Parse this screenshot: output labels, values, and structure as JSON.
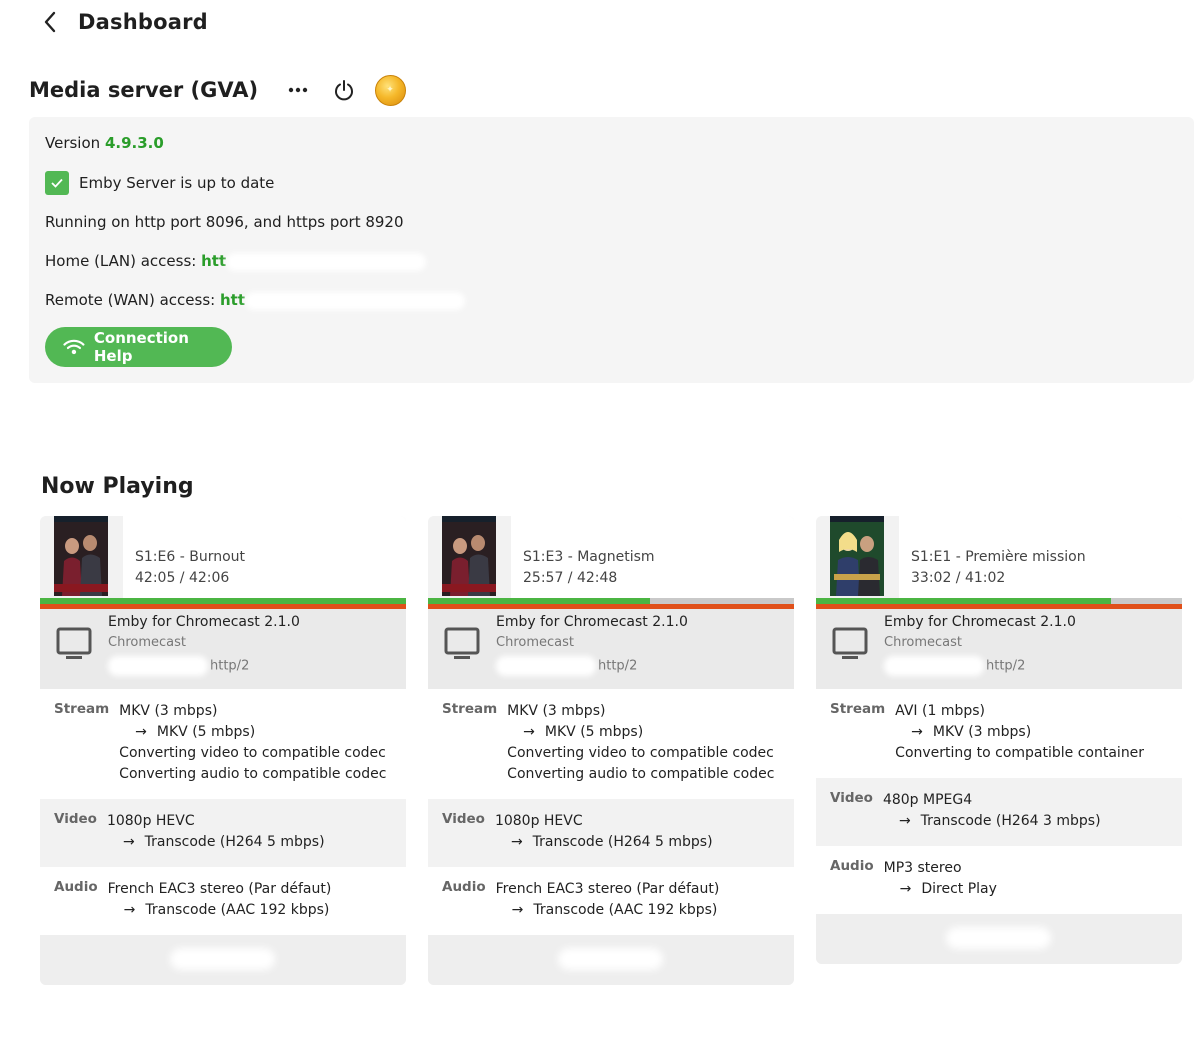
{
  "header": {
    "title": "Dashboard"
  },
  "server": {
    "name": "Media server (GVA)",
    "version_label": "Version ",
    "version": "4.9.3.0",
    "update_status": "Emby Server is up to date",
    "ports_text": "Running on http port 8096, and https port 8920",
    "lan_label": "Home (LAN) access: ",
    "lan_url_visible": "htt",
    "wan_label": "Remote (WAN) access: ",
    "wan_url_visible": "htt",
    "connection_help_label": "Connection Help"
  },
  "now_playing": {
    "title": "Now Playing",
    "sessions": [
      {
        "episode": "S1:E6 - Burnout",
        "time": "42:05 / 42:06",
        "progress": 0.999,
        "device_app": "Emby for Chromecast 2.1.0",
        "device_type": "Chromecast",
        "protocol": "http/2",
        "stream_label": "Stream",
        "stream_lines": [
          "MKV (3 mbps)",
          "MKV (5 mbps)",
          "Converting video to compatible codec",
          "Converting audio to compatible codec"
        ],
        "video_label": "Video",
        "video_lines": [
          "1080p HEVC",
          "Transcode (H264 5 mbps)"
        ],
        "audio_label": "Audio",
        "audio_lines": [
          "French EAC3 stereo (Par défaut)",
          "Transcode (AAC 192 kbps)"
        ]
      },
      {
        "episode": "S1:E3 - Magnetism",
        "time": "25:57 / 42:48",
        "progress": 0.606,
        "device_app": "Emby for Chromecast 2.1.0",
        "device_type": "Chromecast",
        "protocol": "http/2",
        "stream_label": "Stream",
        "stream_lines": [
          "MKV (3 mbps)",
          "MKV (5 mbps)",
          "Converting video to compatible codec",
          "Converting audio to compatible codec"
        ],
        "video_label": "Video",
        "video_lines": [
          "1080p HEVC",
          "Transcode (H264 5 mbps)"
        ],
        "audio_label": "Audio",
        "audio_lines": [
          "French EAC3 stereo (Par défaut)",
          "Transcode (AAC 192 kbps)"
        ]
      },
      {
        "episode": "S1:E1 - Première mission",
        "time": "33:02 / 41:02",
        "progress": 0.805,
        "device_app": "Emby for Chromecast 2.1.0",
        "device_type": "Chromecast",
        "protocol": "http/2",
        "stream_label": "Stream",
        "stream_lines": [
          "AVI (1 mbps)",
          "MKV (3 mbps)",
          "Converting to compatible container"
        ],
        "video_label": "Video",
        "video_lines": [
          "480p MPEG4",
          "Transcode (H264 3 mbps)"
        ],
        "audio_label": "Audio",
        "audio_lines": [
          "MP3 stereo",
          "Direct Play"
        ]
      }
    ]
  },
  "colors": {
    "accent_green": "#52b854",
    "version_green": "#2a9d2a",
    "transcode_orange": "#e0501a"
  }
}
